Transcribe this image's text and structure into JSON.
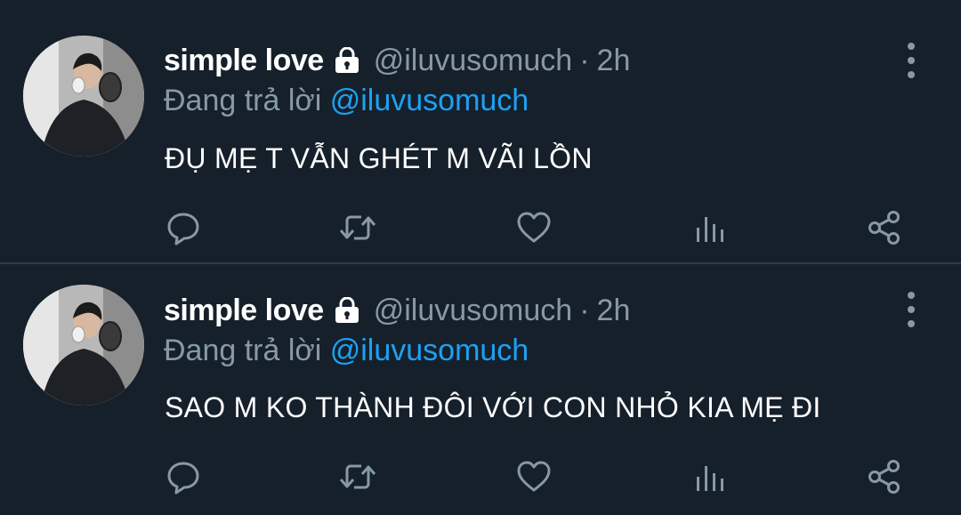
{
  "colors": {
    "background": "#15202b",
    "divider": "#2f3b47",
    "secondary_text": "#8899a6",
    "mention": "#1da1f2",
    "primary_text": "#ffffff"
  },
  "tweets": [
    {
      "display_name": "simple love",
      "handle": "@iluvusomuch",
      "separator": "·",
      "time": "2h",
      "reply_prefix": "Đang trả lời",
      "reply_to": "@iluvusomuch",
      "text": "ĐỤ MẸ T VẪN GHÉT M VÃI LỒN",
      "icons": [
        "lock-icon",
        "more-vertical-icon",
        "reply-icon",
        "retweet-icon",
        "like-icon",
        "analytics-icon",
        "share-icon"
      ]
    },
    {
      "display_name": "simple love",
      "handle": "@iluvusomuch",
      "separator": "·",
      "time": "2h",
      "reply_prefix": "Đang trả lời",
      "reply_to": "@iluvusomuch",
      "text": "SAO M KO THÀNH ĐÔI VỚI CON NHỎ KIA MẸ ĐI",
      "icons": [
        "lock-icon",
        "more-vertical-icon",
        "reply-icon",
        "retweet-icon",
        "like-icon",
        "analytics-icon",
        "share-icon"
      ]
    }
  ]
}
